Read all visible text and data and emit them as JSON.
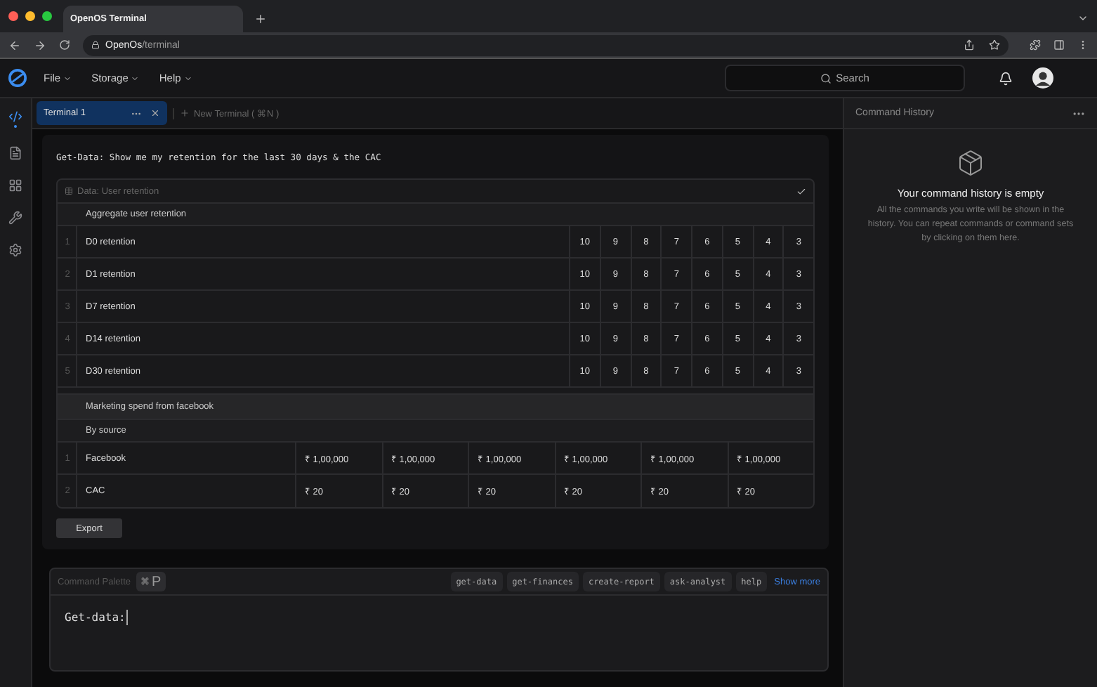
{
  "browser": {
    "tab_title": "OpenOS Terminal",
    "url_host": "OpenOs",
    "url_path": "/terminal"
  },
  "menu": [
    {
      "label": "File"
    },
    {
      "label": "Storage"
    },
    {
      "label": "Help"
    }
  ],
  "search": {
    "placeholder": "Search"
  },
  "sidebar": [
    {
      "kind": "code",
      "selected": true
    },
    {
      "kind": "file",
      "selected": false
    },
    {
      "kind": "grid",
      "selected": false
    },
    {
      "kind": "tools",
      "selected": false
    },
    {
      "kind": "settings",
      "selected": false
    }
  ],
  "terminal_tabs": [
    {
      "label": "Terminal 1",
      "selected": true
    }
  ],
  "new_terminal": "New Terminal ( ⌘N )",
  "prompt": "Get-Data: Show me my retention for the last 30 days & the CAC",
  "data_card": {
    "title": "Data: User retention",
    "retention": {
      "heading": "Aggregate user retention",
      "rows": [
        {
          "index": "1",
          "label": "D0 retention",
          "values": [
            "10",
            "9",
            "8",
            "7",
            "6",
            "5",
            "4",
            "3"
          ]
        },
        {
          "index": "2",
          "label": "D1 retention",
          "values": [
            "10",
            "9",
            "8",
            "7",
            "6",
            "5",
            "4",
            "3"
          ]
        },
        {
          "index": "3",
          "label": "D7 retention",
          "values": [
            "10",
            "9",
            "8",
            "7",
            "6",
            "5",
            "4",
            "3"
          ]
        },
        {
          "index": "4",
          "label": "D14 retention",
          "values": [
            "10",
            "9",
            "8",
            "7",
            "6",
            "5",
            "4",
            "3"
          ]
        },
        {
          "index": "5",
          "label": "D30 retention",
          "values": [
            "10",
            "9",
            "8",
            "7",
            "6",
            "5",
            "4",
            "3"
          ]
        }
      ]
    },
    "marketing": {
      "heading": "Marketing spend from facebook",
      "subheading": "By source",
      "rows": [
        {
          "index": "1",
          "label": "Facebook",
          "values": [
            "₹ 1,00,000",
            "₹ 1,00,000",
            "₹ 1,00,000",
            "₹ 1,00,000",
            "₹ 1,00,000",
            "₹ 1,00,000"
          ]
        },
        {
          "index": "2",
          "label": "CAC",
          "values": [
            "₹ 20",
            "₹ 20",
            "₹ 20",
            "₹ 20",
            "₹ 20",
            "₹ 20"
          ]
        }
      ]
    },
    "export_button": "Export"
  },
  "palette": {
    "label": "Command Palette",
    "shortcut_symbol": "⌘",
    "shortcut_key": "P",
    "commands": [
      "get-data",
      "get-finances",
      "create-report",
      "ask-analyst",
      "help"
    ],
    "show_more": "Show more",
    "value": "Get-data:"
  },
  "history": {
    "title": "Command History",
    "empty_title": "Your command history is empty",
    "empty_text": "All the commands you write will be shown in the history. You can repeat commands or command sets by clicking on them here."
  }
}
